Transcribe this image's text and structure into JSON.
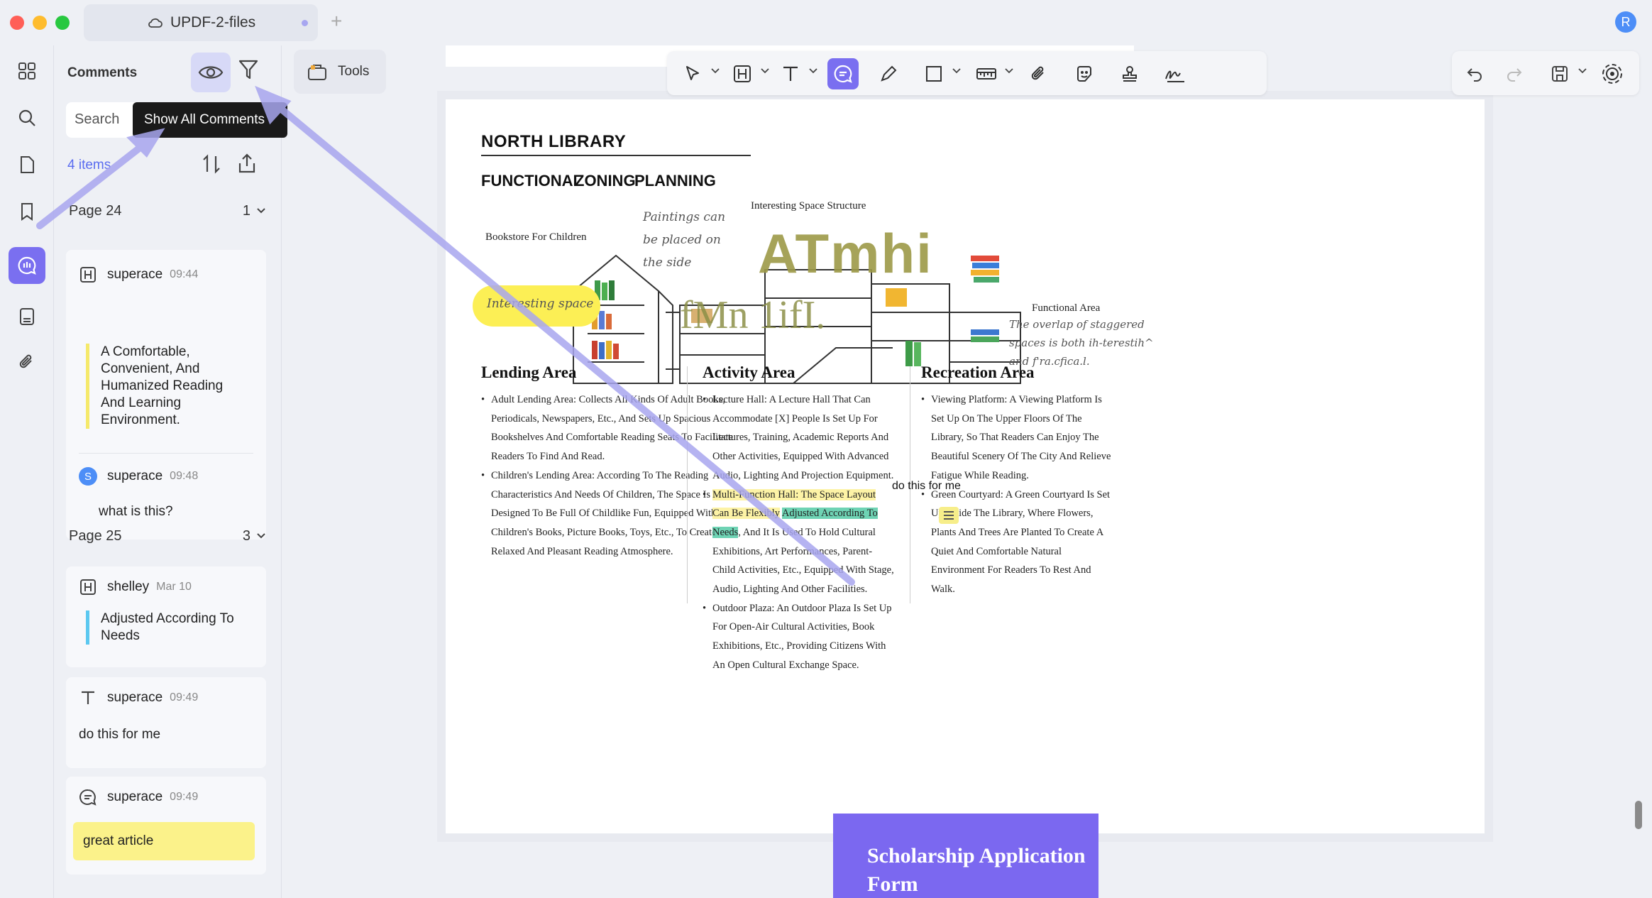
{
  "window": {
    "tab_title": "UPDF-2-files",
    "new_tab": "+",
    "avatar_letter": "R",
    "traffic_lights": [
      "#ff5f57",
      "#febc2e",
      "#28c840"
    ]
  },
  "rail": {
    "items": [
      "thumbnails-icon",
      "search-icon",
      "pages-icon",
      "bookmark-icon",
      "comments-icon",
      "organize-icon",
      "attachment-icon"
    ],
    "active": "comments-icon"
  },
  "panel": {
    "title": "Comments",
    "search_placeholder": "Search",
    "tooltip": "Show All Comments",
    "items_count": "4 items",
    "groups": [
      {
        "page": "Page 24",
        "count": "1",
        "comments": [
          {
            "author": "superace",
            "time": "09:44",
            "type": "highlight",
            "quote": "A Comfortable, Convenient, And Humanized Reading And Learning Environment.",
            "quote_color": "#f5e96b"
          },
          {
            "author": "superace",
            "time": "09:48",
            "type": "reply",
            "avatar": "S",
            "text": "what is this?"
          }
        ]
      },
      {
        "page": "Page 25",
        "count": "3",
        "comments": [
          {
            "author": "shelley",
            "time": "Mar 10",
            "type": "highlight",
            "quote": "Adjusted According To Needs",
            "quote_color": "#5bc8f0"
          },
          {
            "author": "superace",
            "time": "09:49",
            "type": "text",
            "text": "do this for me"
          },
          {
            "author": "superace",
            "time": "09:49",
            "type": "note",
            "text": "great article",
            "note_color": "#fbf28a"
          }
        ]
      }
    ]
  },
  "tools": {
    "label": "Tools"
  },
  "document": {
    "title": "NORTH LIBRARY",
    "subtitles": [
      "FUNCTIONAL",
      "ZONING",
      "PLANNING"
    ],
    "annotations": {
      "paintings": "Paintings can be placed on the side",
      "space_structure": "Interesting Space Structure",
      "bookstore": "Bookstore For Children",
      "interesting_space": "Interesting space",
      "functional_area": "Functional Area",
      "overlap_note": "The overlap of staggered spaces is both ih-terestih^ and f'ra.cfica.l.",
      "stamp_atmhi": "ATmhi",
      "stamp_fmn": "fMn 1ifI."
    },
    "columns": [
      {
        "title": "Lending Area",
        "items": [
          "Adult Lending Area: Collects All Kinds Of Adult Books, Periodicals, Newspapers, Etc., And Sets Up Spacious Bookshelves And Comfortable Reading Seats To Facilitate Readers To Find And Read.",
          "Children's Lending Area: According To The Reading Characteristics And Needs Of Children, The Space Is Designed To Be Full Of Childlike Fun, Equipped With Children's Books, Picture Books, Toys, Etc., To Create A Relaxed And Pleasant Reading Atmosphere."
        ]
      },
      {
        "title": "Activity Area",
        "items": [
          "Lecture Hall: A Lecture Hall That Can Accommodate [X] People Is Set Up For Lectures, Training, Academic Reports And Other Activities, Equipped With Advanced Audio, Lighting And Projection Equipment.",
          "Multi-Function Hall: The Space Layout Can Be Flexibly Adjusted According To Needs, And It Is Used To Hold Cultural Exhibitions, Art Performances, Parent-Child Activities, Etc., Equipped With Stage, Audio, Lighting And Other Facilities.",
          "Outdoor Plaza: An Outdoor Plaza Is Set Up For Open-Air Cultural Activities, Book Exhibitions, Etc., Providing Citizens With An Open Cultural Exchange Space."
        ],
        "mf_part1": "Multi-Function Hall: The Space Layout Can Be Flexibly",
        "mf_part2": "Adjusted According To Needs",
        "mf_part3": ", And It Is Used To Hold Cultural Exhibitions, Art Performances, Parent-Child Activities, Etc., Equipped With Stage, Audio, Lighting And Other Facilities."
      },
      {
        "title": "Recreation Area",
        "items": [
          "Viewing Platform: A Viewing Platform Is Set Up On The Upper Floors Of The Library, So That Readers Can Enjoy The Beautiful Scenery Of The City And Relieve Fatigue While Reading.",
          "Green Courtyard: A Green Courtyard Is Set Up Inside The Library, Where Flowers, Plants And Trees Are Planted To Create A Quiet And Comfortable Natural Environment For Readers To Rest And Walk."
        ]
      }
    ],
    "free_text": "do this for me",
    "next_page_title": "Scholarship Application Form"
  },
  "toolbar": {
    "items": [
      "select-icon",
      "highlight-icon",
      "text-icon",
      "comment-icon",
      "pen-icon",
      "shape-icon",
      "measure-icon",
      "attach-icon",
      "sticker-icon",
      "stamp-icon",
      "signature-icon"
    ],
    "active": "comment-icon",
    "right_items": [
      "undo-icon",
      "redo-icon",
      "save-icon",
      "ai-icon"
    ]
  },
  "colors": {
    "accent": "#7a6ff0",
    "highlight_yellow": "#fdf3a6",
    "highlight_green": "#6ed3b4"
  }
}
